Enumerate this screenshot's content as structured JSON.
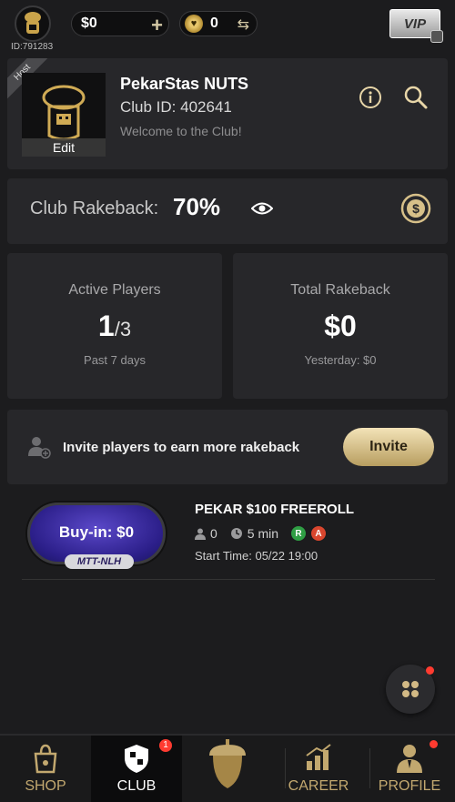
{
  "topbar": {
    "user_id": "ID:791283",
    "balance": "$0",
    "balance_add_icon": "plus-icon",
    "coins": "0",
    "swap_icon": "swap-icon",
    "vip_label": "VIP"
  },
  "club": {
    "host_label": "Host",
    "name": "PekarStas NUTS",
    "club_id": "Club ID: 402641",
    "welcome": "Welcome to the Club!",
    "edit_label": "Edit"
  },
  "rakeback": {
    "label": "Club Rakeback:",
    "value": "70%"
  },
  "stats": {
    "active_players": {
      "title": "Active Players",
      "count": "1",
      "total": "/3",
      "footer": "Past 7 days"
    },
    "total_rakeback": {
      "title": "Total Rakeback",
      "value": "$0",
      "footer": "Yesterday:  $0"
    }
  },
  "invite": {
    "text": "Invite players to earn more rakeback",
    "button": "Invite"
  },
  "tournament": {
    "buyin_label": "Buy-in: $0",
    "game_type": "MTT-NLH",
    "name": "PEKAR $100 FREEROLL",
    "players": "0",
    "duration": "5 min",
    "tag_r": "R",
    "tag_a": "A",
    "start_time": "Start Time: 05/22 19:00"
  },
  "nav": {
    "items": [
      {
        "label": "SHOP",
        "icon": "shop-bag-icon"
      },
      {
        "label": "CLUB",
        "icon": "club-shield-icon",
        "badge": "1"
      },
      {
        "label": "",
        "icon": "acorn-icon"
      },
      {
        "label": "CAREER",
        "icon": "career-chart-icon"
      },
      {
        "label": "PROFILE",
        "icon": "profile-person-icon"
      }
    ]
  },
  "colors": {
    "background": "#1c1c1e",
    "card": "#27272a",
    "gold": "#c2a86f",
    "accent_purple": "#3a2aa8",
    "notification": "#ff3b30"
  }
}
